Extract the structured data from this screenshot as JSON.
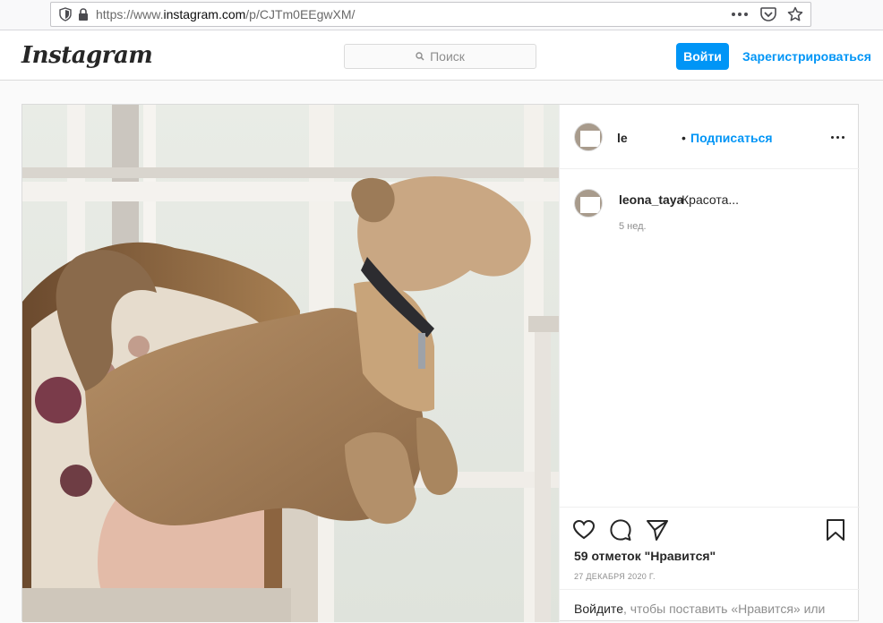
{
  "browser": {
    "url_prefix": "https://www.",
    "url_host": "instagram.com",
    "url_path": "/p/CJTm0EEgwXM/",
    "icons": [
      "shield-icon",
      "lock-icon",
      "more-dots-icon",
      "pocket-icon",
      "star-icon"
    ]
  },
  "header": {
    "logo": "Instagram",
    "search_placeholder": "Поиск",
    "login_label": "Войти",
    "signup_label": "Зарегистрироваться"
  },
  "post": {
    "author_visible": "le",
    "separator": "•",
    "follow_label": "Подписаться",
    "comment": {
      "username": "leona_taya",
      "text": "Красота...",
      "time": "5 нед."
    },
    "likes": "59 отметок \"Нравится\"",
    "date": "27 ДЕКАБРЯ 2020 Г.",
    "login_prompt_link": "Войдите",
    "login_prompt_text": ", чтобы поставить «Нравится» или"
  },
  "colors": {
    "accent": "#0095f6",
    "text": "#262626",
    "muted": "#8e8e8e",
    "border": "#dbdbdb"
  }
}
